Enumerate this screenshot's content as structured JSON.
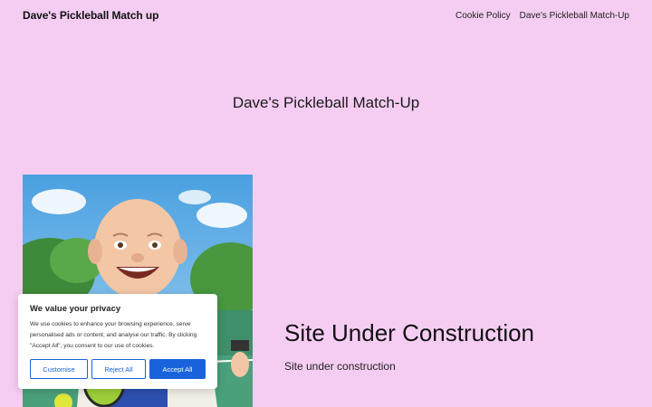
{
  "header": {
    "site_title": "Dave's Pickleball Match up",
    "nav": [
      {
        "label": "Cookie Policy"
      },
      {
        "label": "Dave's Pickleball Match-Up"
      }
    ]
  },
  "main": {
    "page_heading": "Dave's Pickleball Match-Up",
    "section_title": "Site Under Construction",
    "section_text": "Site under construction"
  },
  "cookie_banner": {
    "title": "We value your privacy",
    "text": "We use cookies to enhance your browsing experience, serve personalised ads or content, and analyse our traffic. By clicking \"Accept All\", you consent to our use of cookies.",
    "buttons": {
      "customise": "Customise",
      "reject": "Reject All",
      "accept": "Accept All"
    }
  },
  "colors": {
    "background": "#f5cdf3",
    "accent": "#1863dc"
  }
}
